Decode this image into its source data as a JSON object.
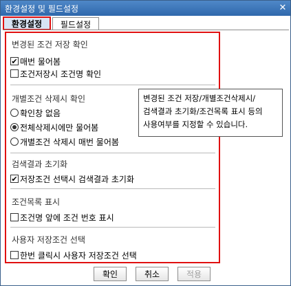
{
  "window": {
    "title": "환경설정 및 필드설정",
    "close_glyph": "✕"
  },
  "tabs": [
    {
      "label": "환경설정",
      "active": true
    },
    {
      "label": "필드설정",
      "active": false
    }
  ],
  "groups": [
    {
      "title": "변경된 조건 저장 확인",
      "options": [
        {
          "type": "checkbox",
          "label": "매번 물어봄",
          "checked": true
        },
        {
          "type": "checkbox",
          "label": "조건저장시 조건명 확인",
          "checked": false
        }
      ]
    },
    {
      "title": "개별조건 삭제시 확인",
      "options": [
        {
          "type": "radio",
          "label": "확인창 없음",
          "checked": false
        },
        {
          "type": "radio",
          "label": "전체삭제시에만 물어봄",
          "checked": true
        },
        {
          "type": "radio",
          "label": "개별조건 삭제시 매번 물어봄",
          "checked": false
        }
      ]
    },
    {
      "title": "검색결과 초기화",
      "options": [
        {
          "type": "checkbox",
          "label": "저장조건 선택시 검색결과 초기화",
          "checked": true
        }
      ]
    },
    {
      "title": "조건목록 표시",
      "options": [
        {
          "type": "checkbox",
          "label": "조건명 앞에 조건 번호 표시",
          "checked": false
        }
      ]
    },
    {
      "title": "사용자 저장조건 선택",
      "options": [
        {
          "type": "checkbox",
          "label": "한번 클릭시 사용자 저장조건 선택",
          "checked": false
        }
      ]
    }
  ],
  "tooltip": {
    "lines": [
      "변경된 조건 저장/개별조건삭제시/",
      "검색결과 초기화/조건목록 표시 등의",
      "사용여부를 지정할 수 있습니다."
    ]
  },
  "buttons": {
    "ok": "확인",
    "cancel": "취소",
    "apply": "적용"
  },
  "colors": {
    "highlight_border": "#e01010",
    "titlebar": "#2f68ac",
    "active_tab_bg": "#d7e4f4"
  }
}
